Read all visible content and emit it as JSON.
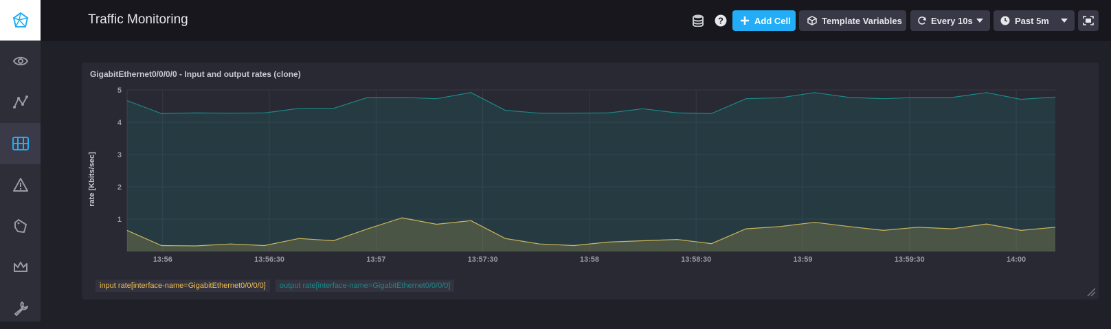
{
  "header": {
    "title": "Traffic Monitoring",
    "add_cell_label": "Add Cell",
    "template_variables_label": "Template Variables",
    "refresh_label": "Every 10s",
    "time_range_label": "Past 5m"
  },
  "sidebar": {
    "items": [
      "eye-icon",
      "graph-icon",
      "dashboards-icon",
      "alert-icon",
      "tag-icon",
      "crown-icon",
      "wrench-icon"
    ],
    "active": "dashboards-icon"
  },
  "cell": {
    "title": "GigabitEthernet0/0/0/0 - Input and output rates (clone)",
    "legend": [
      {
        "label": "input rate[interface-name=GigabitEthernet0/0/0/0]",
        "color": "#f4bf4f"
      },
      {
        "label": "output rate[interface-name=GigabitEthernet0/0/0/0]",
        "color": "#1a8a8a"
      }
    ]
  },
  "chart_data": {
    "type": "area",
    "ylabel": "rate [Kbits/sec]",
    "xlabel": "",
    "ylim": [
      0,
      5
    ],
    "yticks": [
      1,
      2,
      3,
      4,
      5
    ],
    "xlim": [
      "13:55:50",
      "14:00:11"
    ],
    "xticks": [
      {
        "t": "13:56:00",
        "label": "13:56"
      },
      {
        "t": "13:56:30",
        "label": "13:56:30"
      },
      {
        "t": "13:57:00",
        "label": "13:57"
      },
      {
        "t": "13:57:30",
        "label": "13:57:30"
      },
      {
        "t": "13:58:00",
        "label": "13:58"
      },
      {
        "t": "13:58:30",
        "label": "13:58:30"
      },
      {
        "t": "13:59:00",
        "label": "13:59"
      },
      {
        "t": "13:59:30",
        "label": "13:59:30"
      },
      {
        "t": "14:00:00",
        "label": "14:00"
      }
    ],
    "x": [
      "13:55:50",
      "13:55:60",
      "13:56:10",
      "13:56:20",
      "13:56:30",
      "13:56:40",
      "13:56:50",
      "13:57:00",
      "13:57:10",
      "13:57:20",
      "13:57:30",
      "13:57:40",
      "13:57:50",
      "13:58:00",
      "13:58:10",
      "13:58:20",
      "13:58:30",
      "13:58:40",
      "13:58:50",
      "13:59:00",
      "13:59:10",
      "13:59:20",
      "13:59:30",
      "13:59:40",
      "13:59:50",
      "14:00:00",
      "14:00:10"
    ],
    "series": [
      {
        "name": "input rate[interface-name=GigabitEthernet0/0/0/0]",
        "color": "#f4bf4f",
        "values": [
          0.65,
          0.18,
          0.17,
          0.23,
          0.18,
          0.4,
          0.33,
          0.7,
          1.04,
          0.84,
          0.95,
          0.4,
          0.23,
          0.18,
          0.29,
          0.33,
          0.37,
          0.24,
          0.7,
          0.77,
          0.9,
          0.77,
          0.65,
          0.75,
          0.7,
          0.85,
          0.65,
          0.75
        ]
      },
      {
        "name": "output rate[interface-name=GigabitEthernet0/0/0/0]",
        "color": "#1a8a8a",
        "values": [
          4.67,
          4.27,
          4.29,
          4.28,
          4.29,
          4.43,
          4.43,
          4.77,
          4.77,
          4.73,
          4.92,
          4.37,
          4.28,
          4.28,
          4.29,
          4.42,
          4.29,
          4.27,
          4.73,
          4.76,
          4.92,
          4.77,
          4.73,
          4.77,
          4.77,
          4.92,
          4.71,
          4.78
        ]
      }
    ]
  }
}
